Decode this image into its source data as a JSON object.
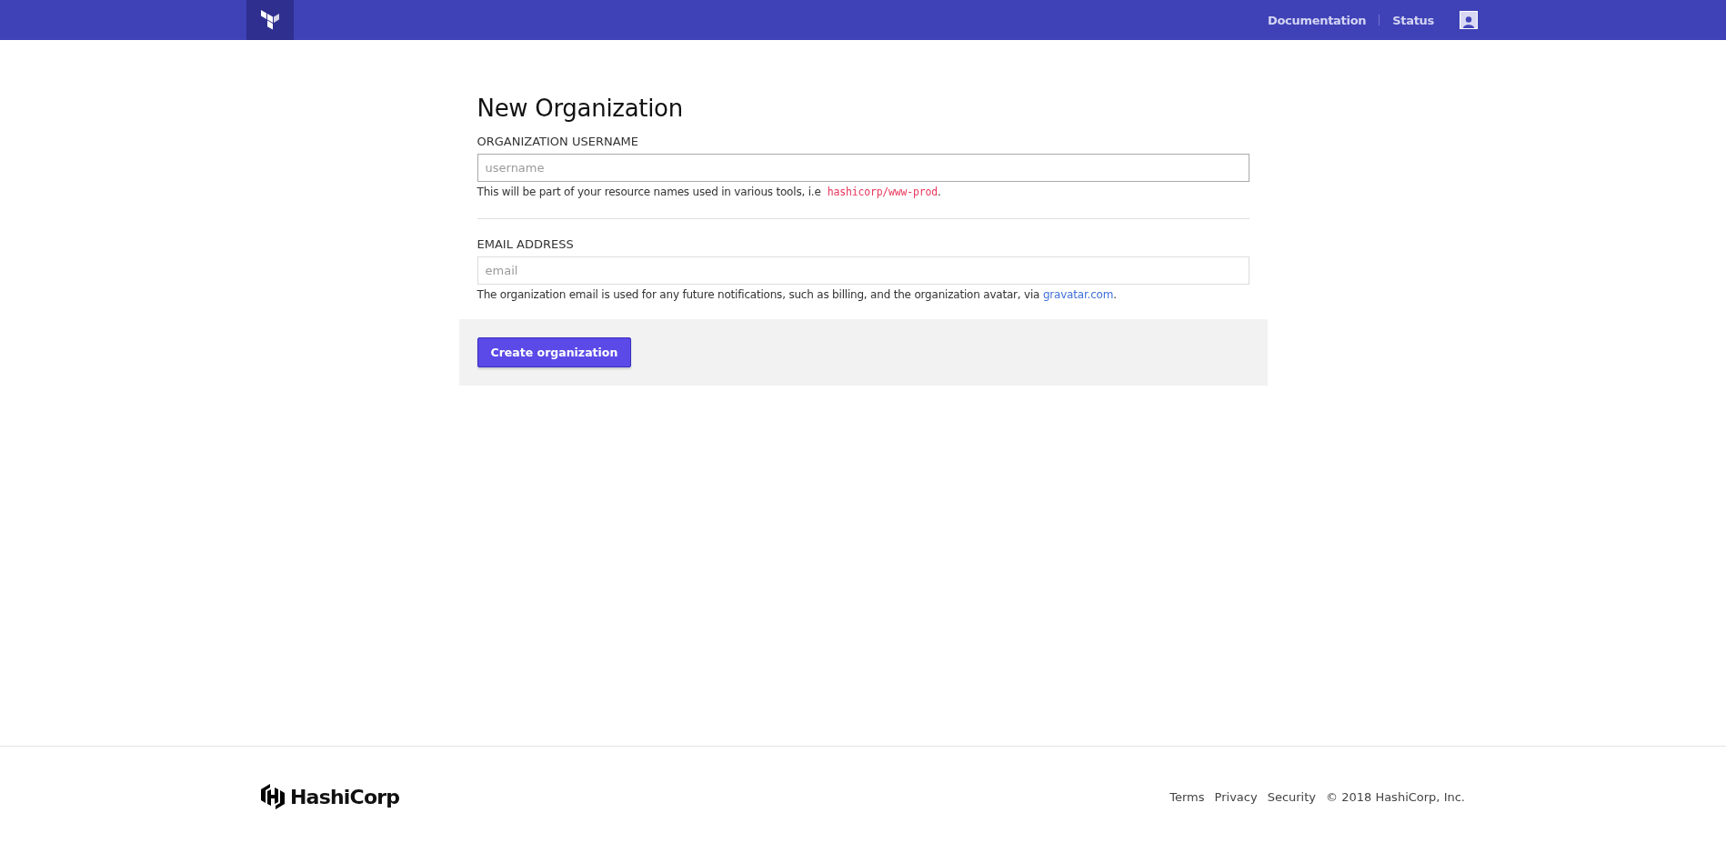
{
  "header": {
    "nav": [
      {
        "label": "Documentation"
      },
      {
        "label": "Status"
      }
    ]
  },
  "form": {
    "title": "New Organization",
    "fields": [
      {
        "label": "ORGANIZATION USERNAME",
        "placeholder": "username",
        "hint": {
          "text": "This will be part of your resource names used in various tools, i.e",
          "code": "hashicorp/www-prod",
          "end": "."
        }
      },
      {
        "label": "EMAIL ADDRESS",
        "placeholder": "email",
        "hint": {
          "text": "The organization email is used for any future notifications, such as billing, and the organization avatar, via",
          "link": "gravatar.com",
          "end": "."
        }
      }
    ],
    "submit": "Create organization"
  },
  "footer": {
    "brand": "HashiCorp",
    "links": [
      "Terms",
      "Privacy",
      "Security"
    ],
    "copyright": "© 2018 HashiCorp, Inc."
  }
}
